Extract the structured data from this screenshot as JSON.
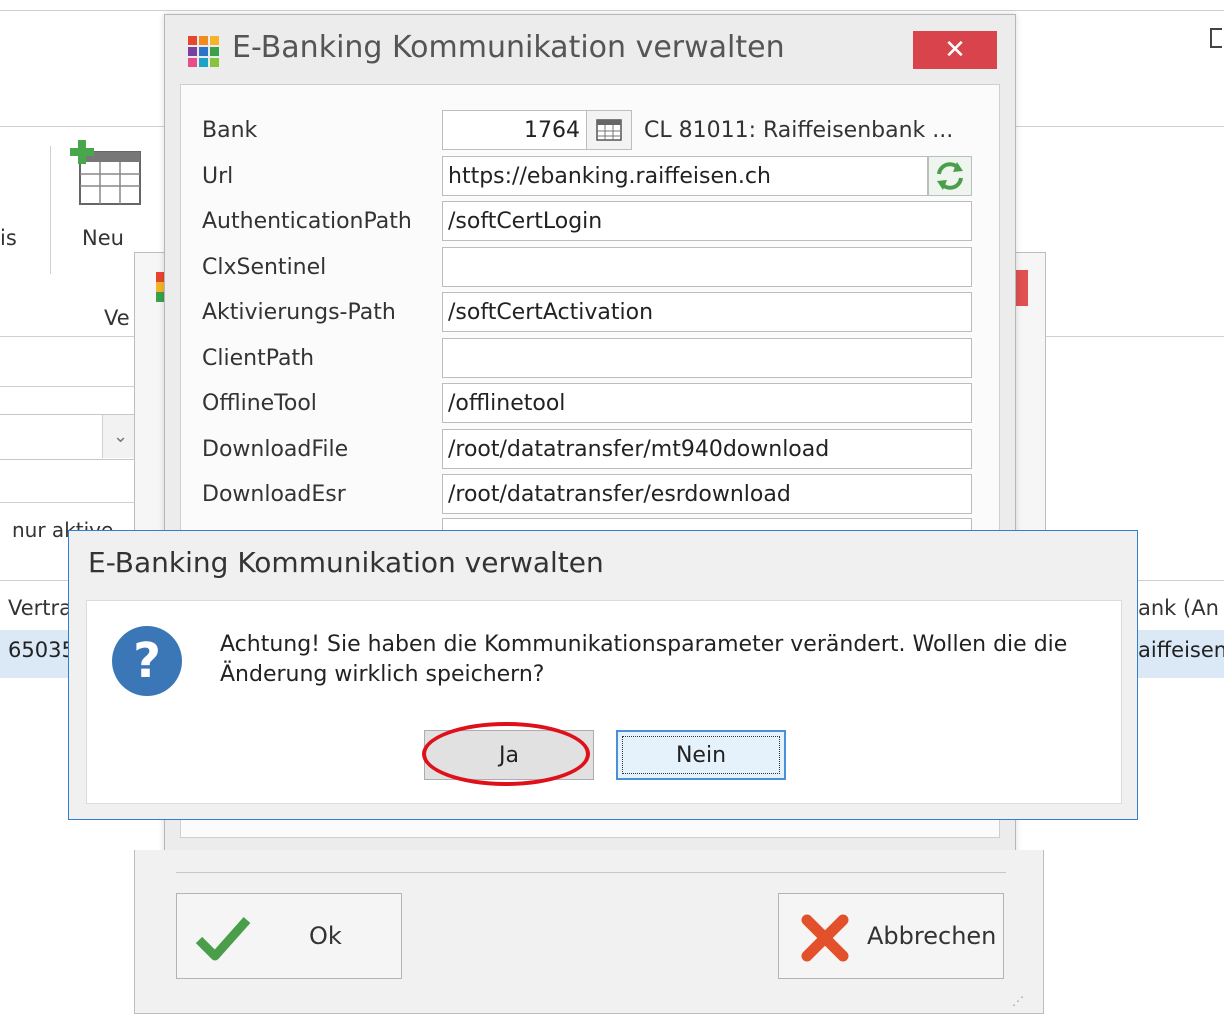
{
  "background": {
    "ribbon_left_text": "is",
    "new_label": "Neu",
    "group_label": "Ve",
    "filter_text": "nur aktive",
    "col_header_left": "Vertra",
    "row_value_left": "65035",
    "col_header_right": "ank (An",
    "row_value_right": "aiffeisen",
    "combo_arrow": "⌄"
  },
  "dialog_main": {
    "title": "E-Banking Kommunikation verwalten",
    "close_label": "✕",
    "fields": [
      {
        "label": "Bank",
        "value": "1764"
      },
      {
        "label": "Url",
        "value": "https://ebanking.raiffeisen.ch"
      },
      {
        "label": "AuthenticationPath",
        "value": "/softCertLogin"
      },
      {
        "label": "ClxSentinel",
        "value": ""
      },
      {
        "label": "Aktivierungs-Path",
        "value": "/softCertActivation"
      },
      {
        "label": "ClientPath",
        "value": ""
      },
      {
        "label": "OfflineTool",
        "value": "/offlinetool"
      },
      {
        "label": "DownloadFile",
        "value": "/root/datatransfer/mt940download"
      },
      {
        "label": "DownloadEsr",
        "value": "/root/datatransfer/esrdownload"
      }
    ],
    "bank_name": "CL 81011: Raiffeisenbank ...",
    "ok_label": "Ok",
    "cancel_label": "Abbrechen"
  },
  "message_box": {
    "title": "E-Banking Kommunikation verwalten",
    "text": "Achtung! Sie haben die Kommunikationsparameter verändert. Wollen die die Änderung wirklich speichern?",
    "icon": "?",
    "yes_label": "Ja",
    "no_label": "Nein"
  },
  "colors": {
    "accent_blue": "#2f7fd2",
    "close_red": "#d9434b",
    "highlight_ring": "#e0101b"
  }
}
